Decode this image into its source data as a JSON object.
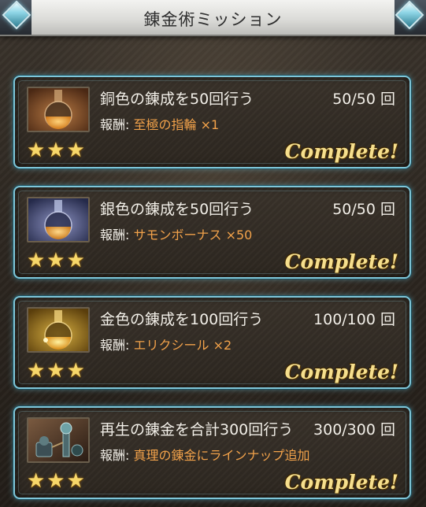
{
  "header": {
    "title": "錬金術ミッション"
  },
  "missions": [
    {
      "title": "銅色の錬成を50回行う",
      "count": "50/50 回",
      "reward_label": "報酬:",
      "reward_value": "至極の指輪 ×1",
      "stars": "★★★",
      "status": "Complete!",
      "icon": "copper-flask-icon"
    },
    {
      "title": "銀色の錬成を50回行う",
      "count": "50/50 回",
      "reward_label": "報酬:",
      "reward_value": "サモンボーナス ×50",
      "stars": "★★★",
      "status": "Complete!",
      "icon": "silver-flask-icon"
    },
    {
      "title": "金色の錬成を100回行う",
      "count": "100/100 回",
      "reward_label": "報酬:",
      "reward_value": "エリクシール ×2",
      "stars": "★★★",
      "status": "Complete!",
      "icon": "gold-flask-icon"
    },
    {
      "title": "再生の錬金を合計300回行う",
      "count": "300/300 回",
      "reward_label": "報酬:",
      "reward_value": "真理の錬金にラインナップ追加",
      "stars": "★★★",
      "status": "Complete!",
      "icon": "alchemy-apparatus-icon"
    }
  ],
  "colors": {
    "card_border": "#7fc6d9",
    "reward_value": "#f2a24a",
    "complete_text": "#f6df8d",
    "star": "#f7d76a"
  }
}
